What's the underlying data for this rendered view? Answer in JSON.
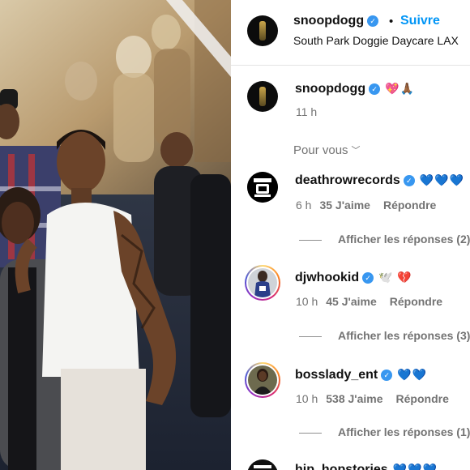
{
  "post": {
    "username": "snoopdogg",
    "separator": "•",
    "follow_label": "Suivre",
    "location": "South Park Doggie Daycare LAX"
  },
  "caption": {
    "username": "snoopdogg",
    "emoji": "💖🙏🏾",
    "time": "11 h"
  },
  "for_you_label": "Pour vous",
  "comments": [
    {
      "username": "deathrowrecords",
      "emoji": "💙💙💙",
      "time": "6 h",
      "likes": "35 J'aime",
      "reply_label": "Répondre",
      "view_replies": "Afficher les réponses (2)"
    },
    {
      "username": "djwhookid",
      "emoji": "🕊️ 💔",
      "time": "10 h",
      "likes": "45 J'aime",
      "reply_label": "Répondre",
      "view_replies": "Afficher les réponses (3)"
    },
    {
      "username": "bosslady_ent",
      "emoji": "💙💙",
      "time": "10 h",
      "likes": "538 J'aime",
      "reply_label": "Répondre",
      "view_replies": "Afficher les réponses (1)"
    },
    {
      "username": "hip_hopstories",
      "emoji": "💙💙💙",
      "time": "",
      "likes": "",
      "reply_label": "",
      "view_replies": ""
    }
  ],
  "icons": {
    "verified": "verified-badge-icon",
    "chevron": "chevron-down-icon"
  },
  "colors": {
    "follow": "#0095f6",
    "verified": "#3897f0",
    "secondary_text": "#737373"
  }
}
